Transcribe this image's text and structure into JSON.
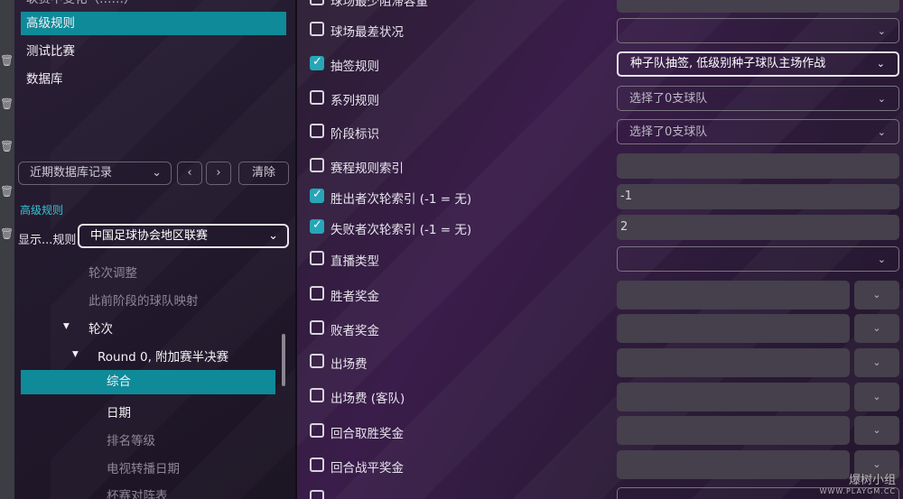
{
  "sidebar": {
    "top_cut_label": "联赛中变化（……）",
    "items": [
      {
        "label": "高级规则",
        "selected": true
      },
      {
        "label": "测试比赛",
        "selected": false
      },
      {
        "label": "数据库",
        "selected": false
      }
    ],
    "history_dropdown": "近期数据库记录",
    "clear_button": "清除",
    "section_label": "高级规则",
    "show_rules_label": "显示...规则",
    "show_rules_value": "中国足球协会地区联赛",
    "tree": [
      {
        "label": "轮次调整",
        "level": 2,
        "style": "dim"
      },
      {
        "label": "此前阶段的球队映射",
        "level": 2,
        "style": "dim"
      },
      {
        "label": "轮次",
        "level": 2,
        "style": "bright",
        "expander": "▾"
      },
      {
        "label": "Round 0, 附加赛半决赛",
        "level": 3,
        "style": "bright",
        "expander": "▾"
      },
      {
        "label": "综合",
        "level": 4,
        "style": "sel"
      },
      {
        "label": "日期",
        "level": 4,
        "style": "bright"
      },
      {
        "label": "排名等级",
        "level": 4,
        "style": "dim"
      },
      {
        "label": "电视转播日期",
        "level": 4,
        "style": "dim"
      },
      {
        "label": "杯赛对阵表",
        "level": 4,
        "style": "dim"
      }
    ]
  },
  "rules": [
    {
      "label": "球场最少阻滞容量",
      "checked": false,
      "field": "field",
      "value": ""
    },
    {
      "label": "球场最差状况",
      "checked": false,
      "field": "select",
      "value": ""
    },
    {
      "label": "抽签规则",
      "checked": true,
      "field": "select-active",
      "value": "种子队抽签, 低级别种子球队主场作战"
    },
    {
      "label": "系列规则",
      "checked": false,
      "field": "select",
      "value": "选择了0支球队"
    },
    {
      "label": "阶段标识",
      "checked": false,
      "field": "select",
      "value": "选择了0支球队"
    },
    {
      "label": "赛程规则索引",
      "checked": false,
      "field": "field",
      "value": ""
    },
    {
      "label": "胜出者次轮索引 (-1 = 无)",
      "checked": true,
      "field": "field",
      "value": "-1"
    },
    {
      "label": "失败者次轮索引 (-1 = 无)",
      "checked": true,
      "field": "field",
      "value": "2"
    },
    {
      "label": "直播类型",
      "checked": false,
      "field": "select",
      "value": ""
    },
    {
      "label": "胜者奖金",
      "checked": false,
      "field": "num",
      "value": ""
    },
    {
      "label": "败者奖金",
      "checked": false,
      "field": "num",
      "value": ""
    },
    {
      "label": "出场费",
      "checked": false,
      "field": "num",
      "value": ""
    },
    {
      "label": "出场费 (客队)",
      "checked": false,
      "field": "num",
      "value": ""
    },
    {
      "label": "回合取胜奖金",
      "checked": false,
      "field": "num",
      "value": ""
    },
    {
      "label": "回合战平奖金",
      "checked": false,
      "field": "num",
      "value": ""
    }
  ],
  "watermark": {
    "brand": "爆树小组",
    "url": "WWW.PLAYGM.CC"
  },
  "icons": {
    "trash": "trash-icon",
    "chevron": "chevron-down-icon",
    "back": "chevron-left-icon",
    "forward": "chevron-right-icon"
  },
  "colors": {
    "accent": "#0f8a99",
    "check": "#27a6b8",
    "section_label": "#38c4d6"
  }
}
